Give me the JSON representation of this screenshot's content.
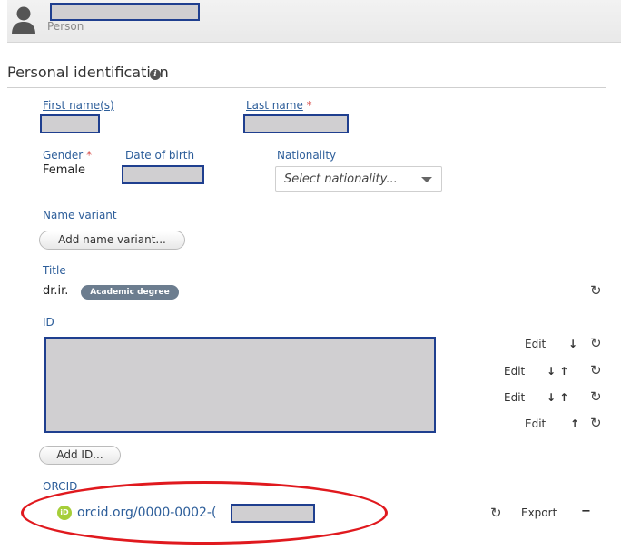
{
  "header": {
    "subtitle": "Person"
  },
  "section": {
    "title": "Personal identification",
    "info_glyph": "i"
  },
  "fields": {
    "first_name": {
      "label": "First name(s)"
    },
    "last_name": {
      "label": "Last name",
      "required": "*"
    },
    "gender": {
      "label": "Gender",
      "required": "*",
      "value": "Female"
    },
    "date_of_birth": {
      "label": "Date of birth"
    },
    "nationality": {
      "label": "Nationality",
      "placeholder": "Select nationality..."
    }
  },
  "name_variant": {
    "label": "Name variant",
    "button": "Add name variant..."
  },
  "title": {
    "label": "Title",
    "value": "dr.ir.",
    "badge": "Academic degree"
  },
  "id": {
    "label": "ID",
    "rows": [
      {
        "edit": "Edit",
        "arrows": "↓"
      },
      {
        "edit": "Edit",
        "arrows": "↓ ↑"
      },
      {
        "edit": "Edit",
        "arrows": "↓ ↑"
      },
      {
        "edit": "Edit",
        "arrows": "↑"
      }
    ],
    "add_button": "Add ID..."
  },
  "orcid": {
    "label": "ORCID",
    "icon_text": "iD",
    "link": "orcid.org/0000-0002-(",
    "export": "Export",
    "remove": "−"
  },
  "glyphs": {
    "refresh": "↻"
  },
  "colors": {
    "label_blue": "#2d5e9a",
    "required_red": "#d9534f",
    "highlight_red": "#e0191e",
    "orcid_green": "#a6ce39",
    "redaction_border": "#1f3f8f",
    "redaction_fill": "#d0cfd1"
  }
}
